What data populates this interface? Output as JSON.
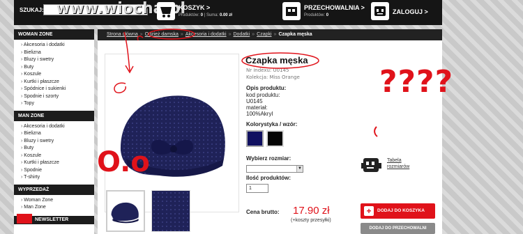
{
  "topbar": {
    "search_label": "SZUKAJ:",
    "watermark": "www.wiocha.pl",
    "cart_title": "KOSZYK >",
    "cart_products_label": "Produktów:",
    "cart_products_value": "0",
    "cart_sum_label": "Suma:",
    "cart_sum_value": "0.00 zł",
    "storage_title": "PRZECHOWALNIA >",
    "storage_products_label": "Produktów:",
    "storage_products_value": "0",
    "login_title": "ZALOGUJ >"
  },
  "sidebar": {
    "woman_title": "WOMAN ZONE",
    "woman_items": [
      "Akcesoria i dodatki",
      "Bielizna",
      "Bluzy i swetry",
      "Buty",
      "Koszule",
      "Kurtki i płaszcze",
      "Spódnice i sukienki",
      "Spodnie i szorty",
      "Topy"
    ],
    "man_title": "MAN ZONE",
    "man_items": [
      "Akcesoria i dodatki",
      "Bielizna",
      "Bluzy i swetry",
      "Buty",
      "Koszule",
      "Kurtki i płaszcze",
      "Spodnie",
      "T-shirty"
    ],
    "sale_title": "WYPRZEDAŻ",
    "sale_items": [
      "Woman Zone",
      "Man Zone"
    ],
    "newsletter": "NEWSLETTER"
  },
  "breadcrumb": {
    "items": [
      "Strona główna",
      "Odzież damska",
      "Akcesoria i dodatki",
      "Dodatki",
      "Czapki"
    ],
    "current": "Czapka męska",
    "separator": "»"
  },
  "product": {
    "title": "Czapka męska",
    "index": "Nr indexu: U0145",
    "collection": "Kolekcja: Miss Orange",
    "desc_heading": "Opis produktu:",
    "desc_lines": [
      "kod produktu:",
      "U0145",
      "materiał:",
      "100%Akryl"
    ],
    "color_heading": "Kolorystyka / wzór:",
    "swatch_colors": [
      "#101060",
      "#050505"
    ],
    "size_heading": "Wybierz rozmiar:",
    "size_value": "",
    "qty_heading": "Ilość produktów:",
    "qty_value": "1",
    "price_label": "Cena brutto:",
    "price_value": "17.90 zł",
    "price_note": "(+koszty przesyłki)",
    "size_table_link": "Tabela rozmiarów",
    "add_to_cart": "DODAJ DO KOSZYKA",
    "add_to_storage": "DODAJ DO PRZECHOWALNI"
  },
  "annotations": {
    "question_marks": "????",
    "oo_text": "O.o"
  },
  "colors": {
    "accent": "#e0121a",
    "dark": "#151515",
    "beanie": "#1f2258"
  }
}
